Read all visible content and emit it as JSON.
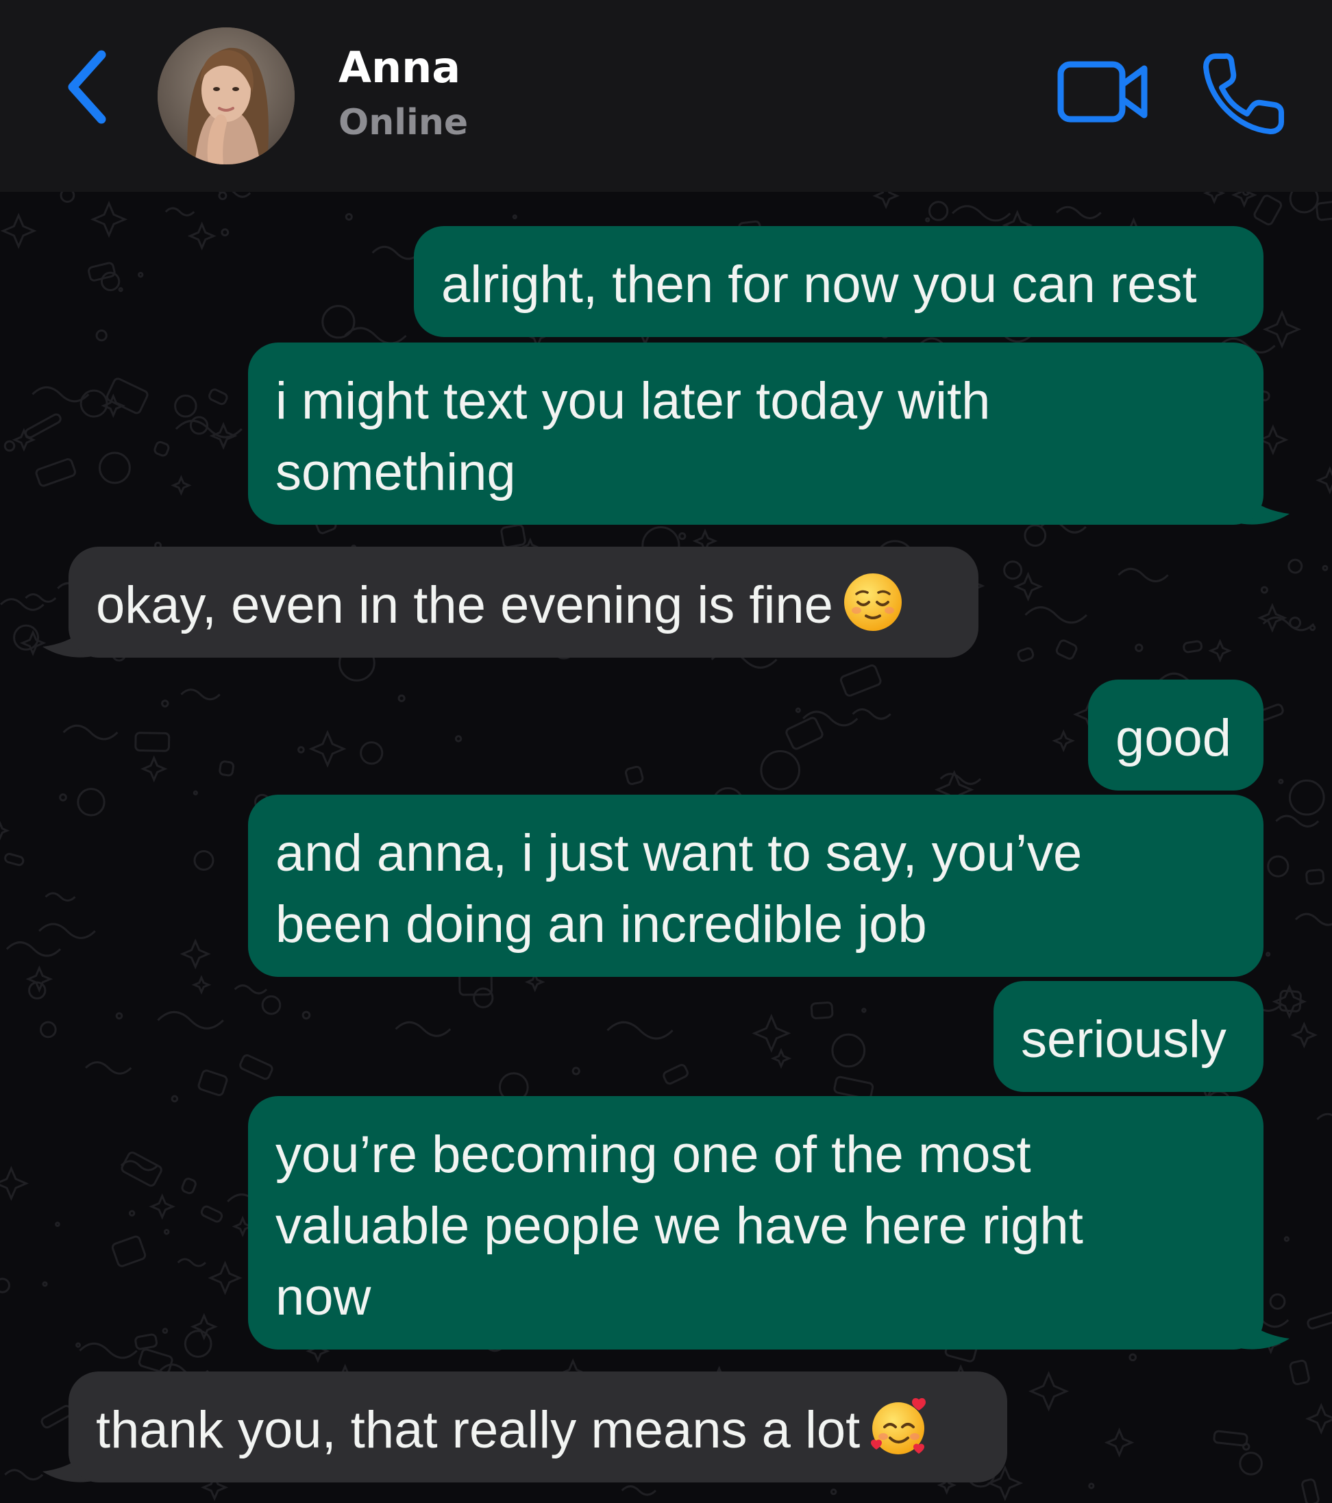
{
  "header": {
    "contact_name": "Anna",
    "status": "Online",
    "back_icon": "chevron-left-icon",
    "video_icon": "video-camera-icon",
    "call_icon": "phone-icon",
    "accent_color": "#1a7cf5"
  },
  "colors": {
    "outgoing_bubble": "#005c4b",
    "incoming_bubble": "#2e2e31",
    "header_background": "#161618",
    "chat_background": "#0b0b0e"
  },
  "messages": [
    {
      "direction": "outgoing",
      "lines": [
        "alright, then for now you can rest"
      ]
    },
    {
      "direction": "outgoing",
      "lines": [
        "i might text you later today with",
        "something"
      ]
    },
    {
      "direction": "incoming",
      "lines": [
        "okay, even in the evening is fine"
      ],
      "emoji": "relieved-face-emoji"
    },
    {
      "direction": "outgoing",
      "lines": [
        "good"
      ]
    },
    {
      "direction": "outgoing",
      "lines": [
        "and anna, i just want to say, you’ve",
        "been doing an incredible job"
      ]
    },
    {
      "direction": "outgoing",
      "lines": [
        "seriously"
      ]
    },
    {
      "direction": "outgoing",
      "lines": [
        "you’re becoming one of the most",
        "valuable people we have here right",
        "now"
      ]
    },
    {
      "direction": "incoming",
      "lines": [
        "thank you, that really means a lot"
      ],
      "emoji": "smiling-face-with-hearts-emoji"
    }
  ]
}
